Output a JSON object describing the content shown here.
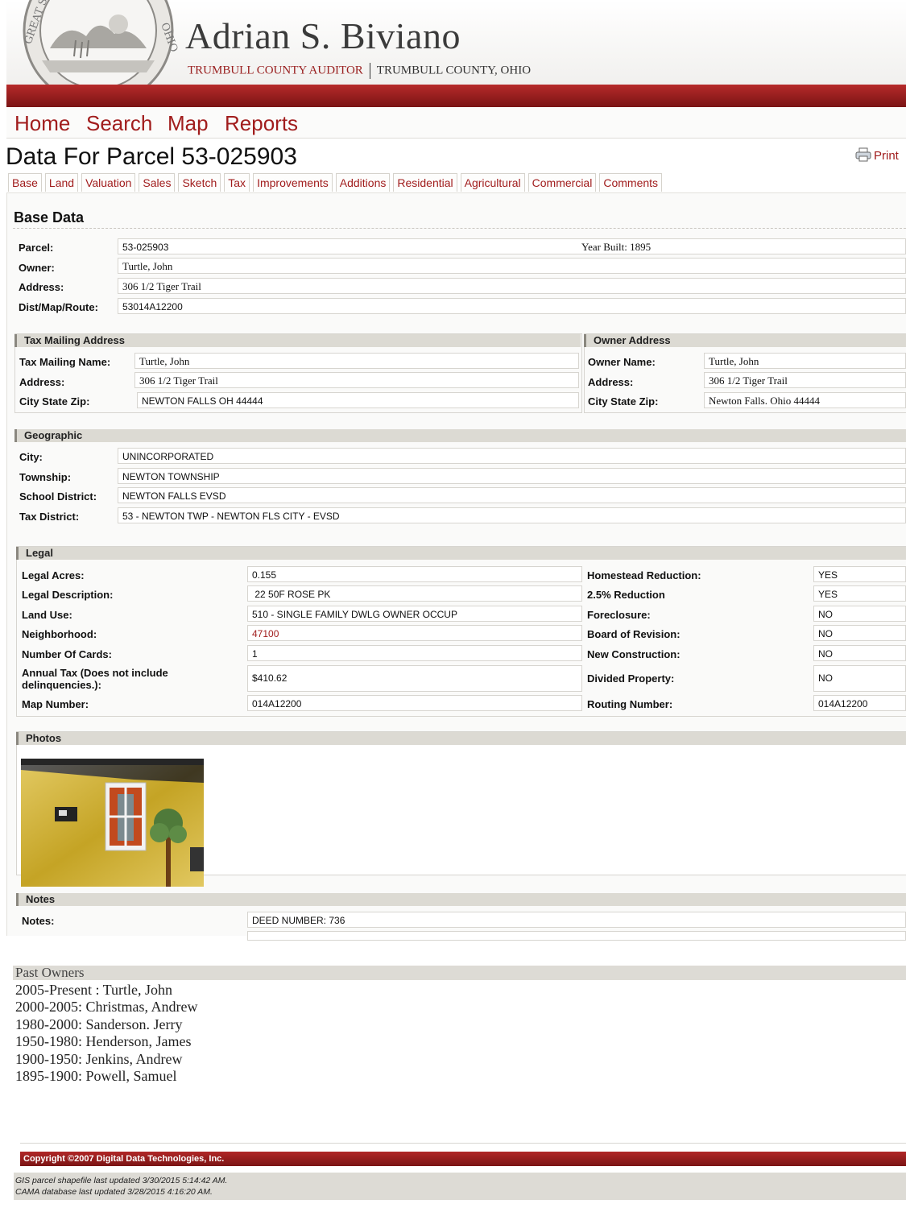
{
  "header": {
    "title": "Adrian S. Biviano",
    "subtitle_left": "TRUMBULL COUNTY AUDITOR",
    "subtitle_right": "TRUMBULL COUNTY, OHIO",
    "seal_text": "GREAT SEAL OF THE STATE OF OHIO"
  },
  "nav": [
    "Home",
    "Search",
    "Map",
    "Reports"
  ],
  "page_title": "Data For Parcel 53-025903",
  "print_label": "Print",
  "tabs": [
    "Base",
    "Land",
    "Valuation",
    "Sales",
    "Sketch",
    "Tax",
    "Improvements",
    "Additions",
    "Residential",
    "Agricultural",
    "Commercial",
    "Comments"
  ],
  "base": {
    "heading": "Base Data",
    "parcel_label": "Parcel:",
    "parcel": "53-025903",
    "year_built": "Year Built: 1895",
    "owner_label": "Owner:",
    "owner": "Turtle, John",
    "address_label": "Address:",
    "address": "306 1/2 Tiger Trail",
    "dist_label": "Dist/Map/Route:",
    "dist": "53014A12200"
  },
  "tax_mailing": {
    "heading": "Tax Mailing Address",
    "name_label": "Tax Mailing Name:",
    "name": "Turtle, John",
    "address_label": "Address:",
    "address": "306 1/2 Tiger Trail",
    "csz_label": "City State Zip:",
    "csz": "NEWTON FALLS OH 44444"
  },
  "owner_address": {
    "heading": "Owner Address",
    "name_label": "Owner Name:",
    "name": "Turtle, John",
    "address_label": "Address:",
    "address": "306 1/2 Tiger Trail",
    "csz_label": "City State Zip:",
    "csz": "Newton Falls. Ohio 44444"
  },
  "geographic": {
    "heading": "Geographic",
    "city_label": "City:",
    "city": "UNINCORPORATED",
    "township_label": "Township:",
    "township": "NEWTON TOWNSHIP",
    "school_label": "School District:",
    "school": "NEWTON FALLS EVSD",
    "taxdist_label": "Tax District:",
    "taxdist": "53 - NEWTON TWP - NEWTON FLS CITY - EVSD"
  },
  "legal": {
    "heading": "Legal",
    "rows_left": [
      {
        "label": "Legal Acres:",
        "value": "0.155"
      },
      {
        "label": "Legal Description:",
        "value": " 22 50F ROSE PK"
      },
      {
        "label": "Land Use:",
        "value": "510 - SINGLE FAMILY DWLG OWNER OCCUP"
      },
      {
        "label": "Neighborhood:",
        "value": "47100"
      },
      {
        "label": "Number Of Cards:",
        "value": "1"
      },
      {
        "label": "Annual Tax (Does not include delinquencies.):",
        "value": "$410.62"
      },
      {
        "label": "Map Number:",
        "value": "014A12200"
      }
    ],
    "rows_right": [
      {
        "label": "Homestead Reduction:",
        "value": "YES"
      },
      {
        "label": "2.5% Reduction",
        "value": "YES"
      },
      {
        "label": "Foreclosure:",
        "value": "NO"
      },
      {
        "label": "Board of Revision:",
        "value": "NO"
      },
      {
        "label": "New Construction:",
        "value": "NO"
      },
      {
        "label": "Divided Property:",
        "value": "NO"
      },
      {
        "label": "Routing Number:",
        "value": "014A12200"
      }
    ]
  },
  "photos": {
    "heading": "Photos"
  },
  "notes": {
    "heading": "Notes",
    "label": "Notes:",
    "value": "DEED NUMBER: 736"
  },
  "past_owners": {
    "heading": "Past Owners",
    "items": [
      "2005-Present : Turtle, John",
      "2000-2005: Christmas, Andrew",
      "1980-2000: Sanderson. Jerry",
      "1950-1980: Henderson, James",
      "1900-1950: Jenkins, Andrew",
      "1895-1900: Powell, Samuel"
    ]
  },
  "footer": {
    "copyright": "Copyright ©2007 Digital Data Technologies, Inc.",
    "gis_update": "GIS parcel shapefile last updated 3/30/2015 5:14:42 AM.",
    "cama_update": "CAMA database last updated 3/28/2015 4:16:20 AM."
  },
  "colors": {
    "brand_red": "#a11d1d",
    "section_gray": "#dcdad3"
  }
}
